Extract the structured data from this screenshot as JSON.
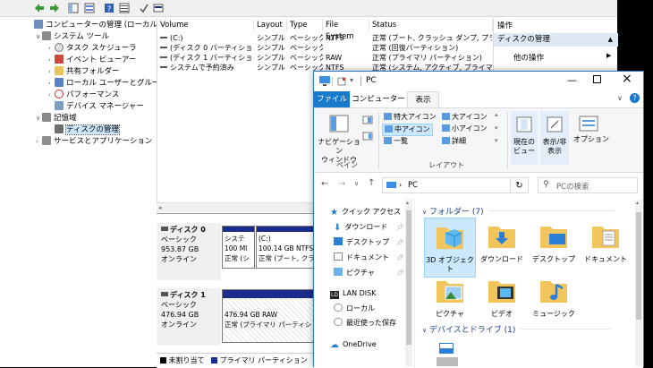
{
  "cm": {
    "tree": [
      {
        "label": "コンピューターの管理 (ローカル)",
        "icon": "computer-management-icon"
      },
      {
        "label": "システム ツール",
        "icon": "tools-icon"
      },
      {
        "label": "タスク スケジューラ",
        "icon": "clock-icon"
      },
      {
        "label": "イベント ビューアー",
        "icon": "event-icon"
      },
      {
        "label": "共有フォルダー",
        "icon": "folder-icon"
      },
      {
        "label": "ローカル ユーザーとグループ",
        "icon": "users-icon"
      },
      {
        "label": "パフォーマンス",
        "icon": "performance-icon"
      },
      {
        "label": "デバイス マネージャー",
        "icon": "device-icon"
      },
      {
        "label": "記憶域",
        "icon": "storage-icon"
      },
      {
        "label": "ディスクの管理",
        "icon": "disk-icon"
      },
      {
        "label": "サービスとアプリケーション",
        "icon": "services-icon"
      }
    ],
    "columns": [
      "Volume",
      "Layout",
      "Type",
      "File System",
      "Status"
    ],
    "rows": [
      [
        "(C:)",
        "シンプル",
        "ベーシック",
        "NTFS",
        "正常 (ブート, クラッシュ ダンプ, プライマリ"
      ],
      [
        "(ディスク 0 パーティション 3)",
        "シンプル",
        "ベーシック",
        "",
        "正常 (回復パーティション)"
      ],
      [
        "(ディスク 1 パーティション 1)",
        "シンプル",
        "ベーシック",
        "RAW",
        "正常 (プライマリ パーティション)"
      ],
      [
        "システムで予約済み",
        "シンプル",
        "ベーシック",
        "NTFS",
        "正常 (システム, アクティブ, プライマリ パ"
      ]
    ],
    "actions": {
      "header": "操作",
      "section": "ディスクの管理",
      "other": "他の操作"
    },
    "disks": [
      {
        "name": "ディスク 0",
        "type": "ベーシック",
        "size": "953.87 GB",
        "status": "オンライン",
        "partitions": [
          {
            "name": "システ",
            "size": "100 MI",
            "status": "正常 (シ"
          },
          {
            "name": "(C:)",
            "size": "100.14 GB NTFS",
            "status": "正常 (ブート, クラッ"
          }
        ]
      },
      {
        "name": "ディスク 1",
        "type": "ベーシック",
        "size": "476.94 GB",
        "status": "オンライン",
        "partitions": [
          {
            "name": "",
            "size": "476.94 GB RAW",
            "status": "正常 (プライマリ パーティション)"
          }
        ]
      }
    ],
    "legend": {
      "unallocated": "未割り当て",
      "primary": "プライマリ パーティション"
    }
  },
  "ex": {
    "title": "PC",
    "tabs": [
      "ファイル",
      "コンピューター",
      "表示"
    ],
    "ribbon": {
      "nav_pane": "ナビゲーション\nウィンドウ",
      "pane_group": "ペイン",
      "layout": [
        "特大アイコン",
        "大アイコン",
        "中アイコン",
        "小アイコン",
        "一覧",
        "詳細"
      ],
      "layout_group": "レイアウト",
      "current_view": "現在の\nビュー",
      "show_hide": "表示/非\n表示",
      "options": "オプション"
    },
    "address": "PC",
    "search_placeholder": "PCの検索",
    "nav": [
      "クイック アクセス",
      "ダウンロード",
      "デスクトップ",
      "ドキュメント",
      "ピクチャ",
      "LAN DISK",
      "ローカル",
      "最近使った保存",
      "OneDrive"
    ],
    "folders_header": "フォルダー (7)",
    "folders": [
      "3D オブジェクト",
      "ダウンロード",
      "デスクトップ",
      "ドキュメント",
      "ピクチャ",
      "ビデオ",
      "ミュージック"
    ],
    "drives_header": "デバイスとドライブ (1)"
  }
}
